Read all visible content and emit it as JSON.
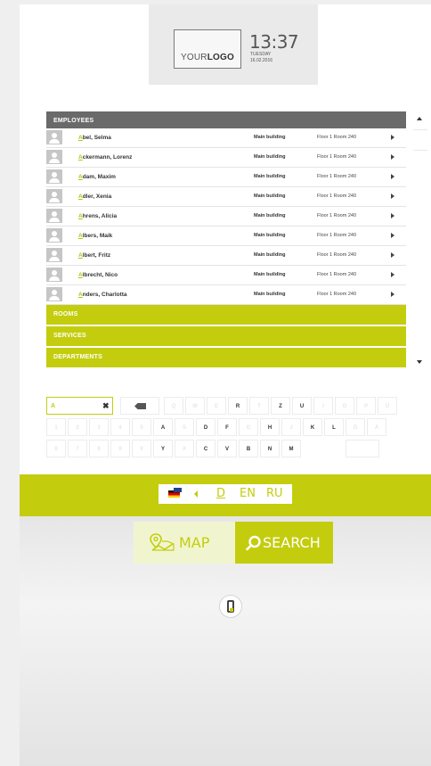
{
  "header": {
    "logo_text_light": "YOUR",
    "logo_text_bold": "LOGO",
    "time": "13:37",
    "weekday": "TUESDAY",
    "date": "16.02.2016"
  },
  "directory": {
    "employees_label": "EMPLOYEES",
    "employees": [
      {
        "name": "Abel, Selma",
        "building": "Main building",
        "room": "Floor 1 Room 240"
      },
      {
        "name": "Ackermann, Lorenz",
        "building": "Main building",
        "room": "Floor 1 Room 240"
      },
      {
        "name": "Adam, Maxim",
        "building": "Main building",
        "room": "Floor 1 Room 240"
      },
      {
        "name": "Adler, Xenia",
        "building": "Main building",
        "room": "Floor 1 Room 240"
      },
      {
        "name": "Ahrens, Alicia",
        "building": "Main building",
        "room": "Floor 1 Room 240"
      },
      {
        "name": "Albers, Maik",
        "building": "Main building",
        "room": "Floor 1 Room 240"
      },
      {
        "name": "Albert, Fritz",
        "building": "Main building",
        "room": "Floor 1 Room 240"
      },
      {
        "name": "Albrecht, Nico",
        "building": "Main building",
        "room": "Floor 1 Room 240"
      },
      {
        "name": "Anders, Charlotta",
        "building": "Main building",
        "room": "Floor 1 Room 240"
      }
    ],
    "rooms_label": "ROOMS",
    "services_label": "SERVICES",
    "departments_label": "DEPARTMENTS"
  },
  "keyboard": {
    "search_value": "A",
    "clear_symbol": "✖",
    "row1": [
      "Q",
      "W",
      "E",
      "R",
      "T",
      "Z",
      "U",
      "I",
      "O",
      "P",
      "Ü"
    ],
    "row2": [
      "1",
      "2",
      "3",
      "4",
      "5",
      "A",
      "S",
      "D",
      "F",
      "G",
      "H",
      "J",
      "K",
      "L",
      "Ö",
      "Ä"
    ],
    "row3": [
      "6",
      "7",
      "8",
      "9",
      "0",
      "Y",
      "X",
      "C",
      "V",
      "B",
      "N",
      "M"
    ]
  },
  "languages": {
    "options": [
      "D",
      "EN",
      "RU"
    ],
    "selected": "D"
  },
  "actions": {
    "map_label": "MAP",
    "search_label": "SEARCH"
  },
  "colors": {
    "accent": "#c3cd0d",
    "section_header": "#6a6a6a",
    "avatar": "#c6c6c6"
  },
  "icons": {
    "flag": "germany-flag-icon",
    "map": "map-pin-icon",
    "search": "search-icon",
    "mobile": "mobile-phone-icon",
    "backspace": "backspace-icon"
  }
}
